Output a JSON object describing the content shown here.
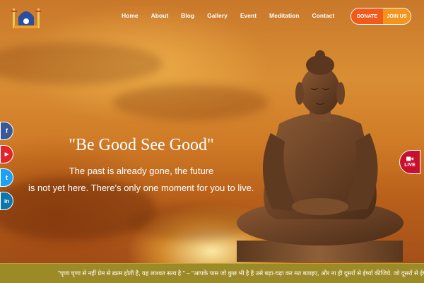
{
  "header": {
    "logo": "temple-logo",
    "nav": [
      "Home",
      "About",
      "Blog",
      "Gallery",
      "Event",
      "Meditation",
      "Contact"
    ],
    "donate_label": "DONATE",
    "join_label": "JOIN US"
  },
  "social": [
    {
      "icon": "facebook-icon",
      "glyph": "f",
      "color": "#3b5998"
    },
    {
      "icon": "youtube-icon",
      "glyph": "▶",
      "color": "#e0262b"
    },
    {
      "icon": "twitter-icon",
      "glyph": "t",
      "color": "#1da1f2"
    },
    {
      "icon": "linkedin-icon",
      "glyph": "in",
      "color": "#0e76a8"
    }
  ],
  "hero": {
    "headline": "\"Be Good See Good\"",
    "line1": "The past is already gone, the future",
    "line2": "is not yet here. There's only one moment for you to live."
  },
  "live": {
    "icon": "video-camera-icon",
    "label": "LIVE"
  },
  "ticker": {
    "text": "\"घृणा घृणा से नहीं प्रेम से ख़त्म होती है, यह शाश्वत सत्य है \" – \"आपके पास जो कुछ भी है है उसे बढ़ा-चढ़ा कर मत बताइए, और ना ही दूसरों से ईर्ष्या कीजिये. जो दूसरों से ईर्ष्या करता है उसे मन की"
  },
  "colors": {
    "donate": "#f05a1a",
    "join": "#f2941e",
    "live": "#c8102e",
    "ticker_bg": "#9c8a27"
  }
}
